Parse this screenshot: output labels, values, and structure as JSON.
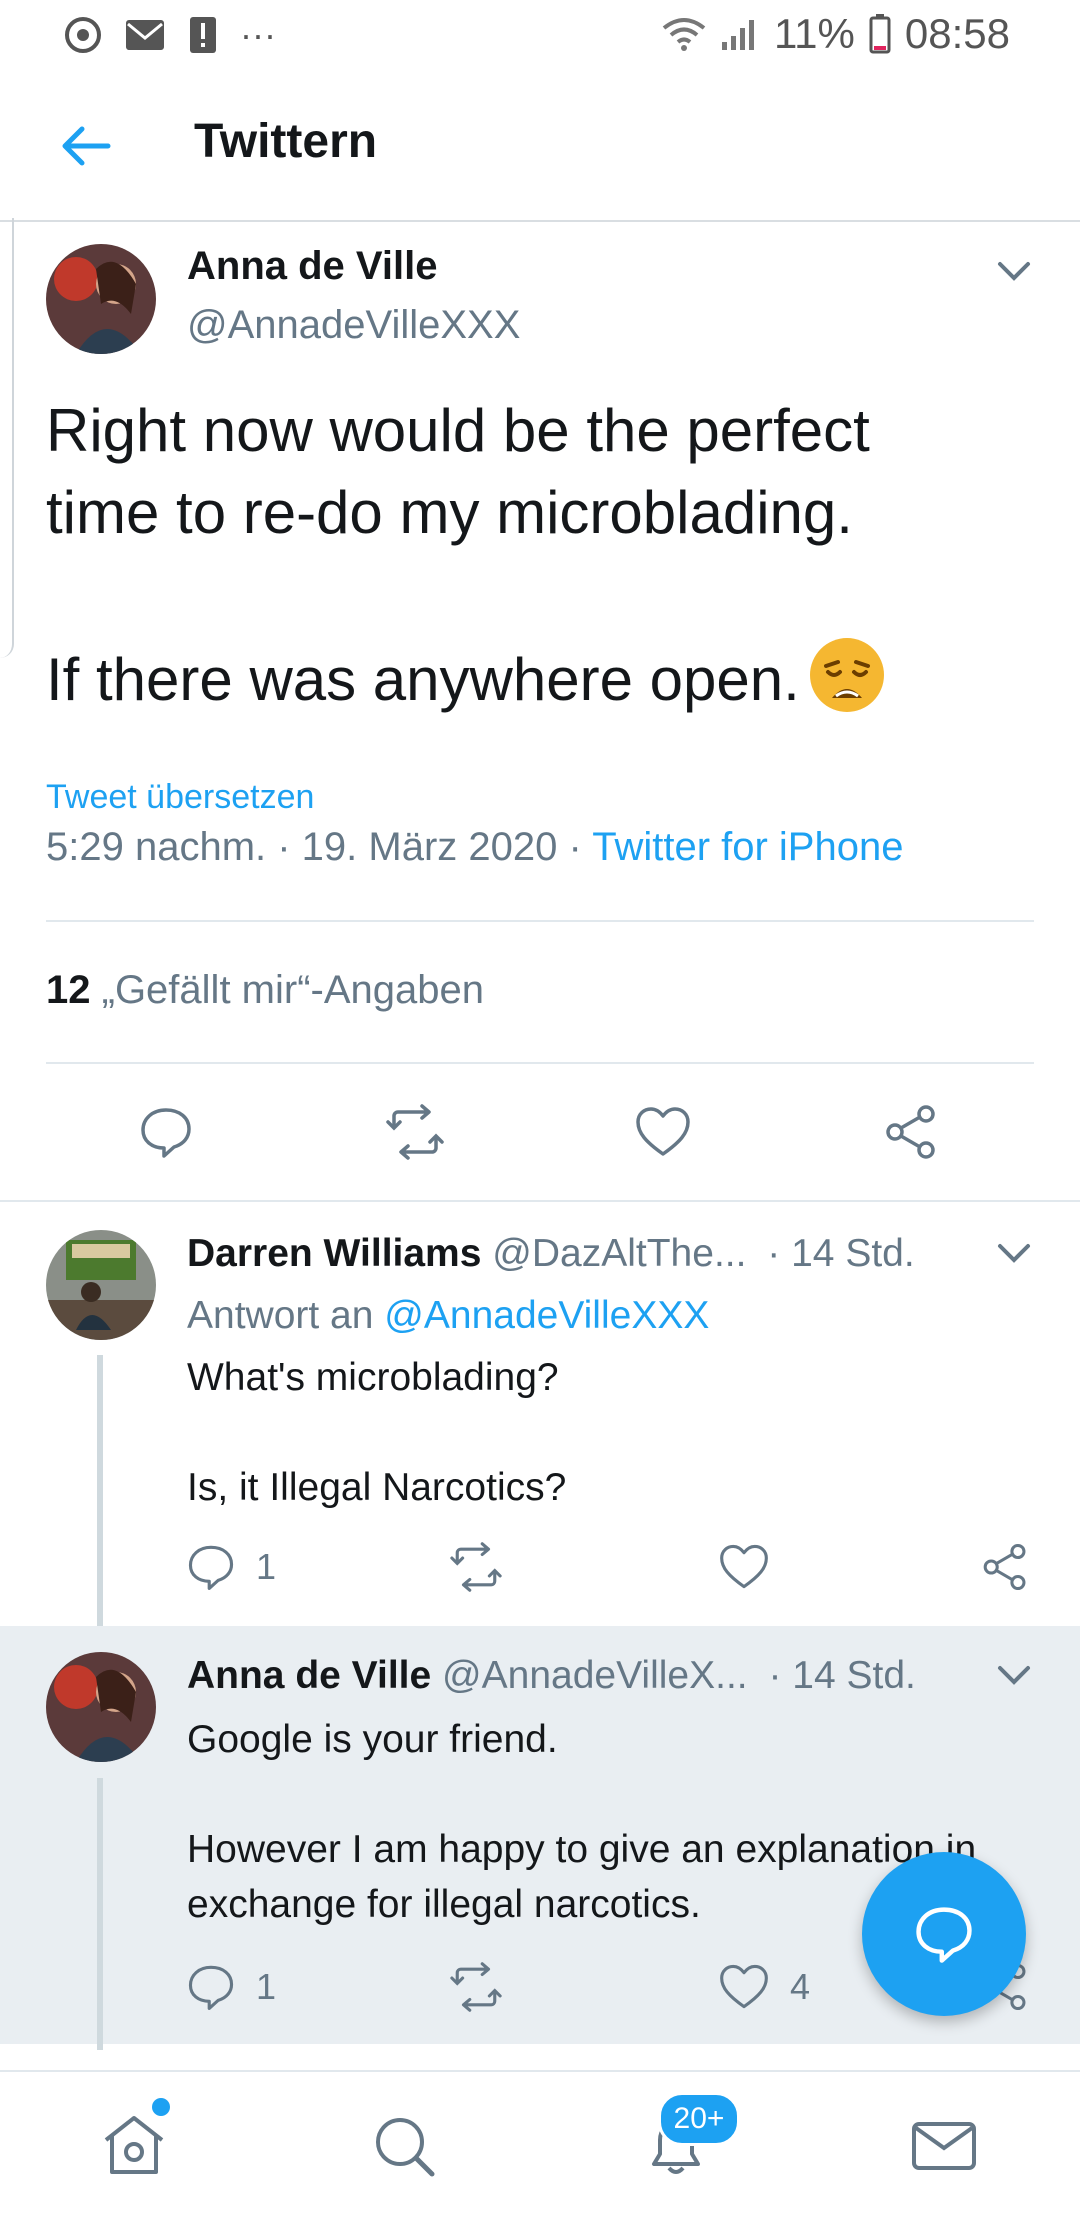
{
  "status_bar": {
    "battery": "11%",
    "time": "08:58",
    "more": "···",
    "icons": [
      "chrome-icon",
      "mail-icon",
      "alert-icon",
      "wifi-icon",
      "signal-icon",
      "battery-icon"
    ]
  },
  "header": {
    "title": "Twittern",
    "back_icon": "back-arrow-icon"
  },
  "main_tweet": {
    "name": "Anna de Ville",
    "handle": "@AnnadeVilleXXX",
    "text_1": "Right now would be the perfect\ntime to re-do my microblading.\n\nIf there was anywhere open.",
    "emoji": "weary-face-emoji",
    "translate": "Tweet übersetzen",
    "timestamp": "5:29 nachm. · 19. März 2020 ·",
    "source": "Twitter for iPhone",
    "likes_count": "12",
    "likes_label": "„Gefällt mir“-Angaben"
  },
  "replies": [
    {
      "name": "Darren Williams",
      "handle": "@DazAltThe...",
      "time": "· 14 Std.",
      "reply_prefix": "Antwort an",
      "reply_to": "@AnnadeVilleXXX",
      "text": "What's microblading?\n\nIs, it Illegal Narcotics?",
      "reply_count": "1",
      "like_count": ""
    },
    {
      "name": "Anna de Ville",
      "handle": "@AnnadeVilleX...",
      "time": "· 14 Std.",
      "text": "Google is your friend.\n\nHowever I am happy to give an explanation in exchange for illegal narcotics.",
      "reply_count": "1",
      "like_count": "4"
    }
  ],
  "bottom_nav": {
    "notifications_badge": "20+"
  },
  "colors": {
    "accent": "#1da1f2",
    "text": "#14171a",
    "secondary": "#657786",
    "highlight": "#e9eef2"
  }
}
